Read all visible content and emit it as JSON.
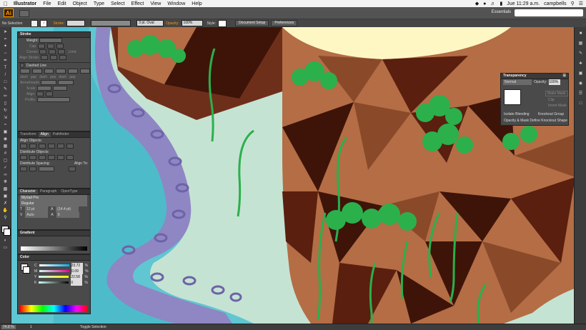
{
  "menubar": {
    "app_name": "Illustrator",
    "items": [
      "File",
      "Edit",
      "Object",
      "Type",
      "Select",
      "Effect",
      "View",
      "Window",
      "Help"
    ],
    "clock": "Jue 11:29 a.m.",
    "user": "campbells"
  },
  "appbar": {
    "logo": "Ai",
    "workspace": "Essentials"
  },
  "controlbar": {
    "selection": "No Selection",
    "stroke_label": "Stroke:",
    "brush": "3 pt. Oval",
    "opacity_label": "Opacity:",
    "opacity_value": "100%",
    "style_label": "Style:",
    "doc_setup": "Document Setup",
    "preferences": "Preferences"
  },
  "stroke_panel": {
    "title": "Stroke",
    "rows": [
      "Weight:",
      "Cap:",
      "Corner:",
      "Align Stroke:"
    ],
    "limit_label": "Limit:",
    "dashed": "Dashed Line",
    "dash_labels": [
      "dash",
      "gap",
      "dash",
      "gap",
      "dash",
      "gap"
    ],
    "arrowheads": "Arrowheads:",
    "scale": "Scale:",
    "align": "Align:",
    "profile": "Profile:"
  },
  "align_panel": {
    "tabs": [
      "Transform",
      "Align",
      "Pathfinder"
    ],
    "align_objects": "Align Objects:",
    "distribute_objects": "Distribute Objects:",
    "distribute_spacing": "Distribute Spacing:",
    "align_to": "Align To:"
  },
  "character_panel": {
    "tabs": [
      "Character",
      "Paragraph",
      "OpenType"
    ],
    "font": "Myriad Pro",
    "style": "Regular",
    "size": "12 pt",
    "leading": "(14.4 pt)",
    "kerning": "Auto",
    "tracking": "0"
  },
  "gradient_panel": {
    "title": "Gradient"
  },
  "color_panel": {
    "title": "Color",
    "channels": [
      {
        "label": "C",
        "value": "23.72",
        "unit": "%"
      },
      {
        "label": "M",
        "value": "0.09",
        "unit": "%"
      },
      {
        "label": "Y",
        "value": "22.58",
        "unit": "%"
      },
      {
        "label": "K",
        "value": "0",
        "unit": "%"
      }
    ]
  },
  "transparency_panel": {
    "title": "Transparency",
    "blend": "Normal",
    "opacity_label": "Opacity:",
    "opacity_value": "100%",
    "make_mask": "Make Mask",
    "clip": "Clip",
    "invert_mask": "Invert Mask",
    "isolate": "Isolate Blending",
    "knockout": "Knockout Group",
    "opacity_mask": "Opacity & Mask Define Knockout Shape"
  },
  "statusbar": {
    "zoom": "74.8 %",
    "page": "1",
    "tool_status": "Toggle Selection"
  },
  "colors": {
    "river": "#5fc6d2",
    "tentacle": "#8f86c4",
    "ground": "#c5e3d3",
    "cliff_light": "#b46d45",
    "cliff_dark": "#3e1409",
    "tree": "#2bb04c",
    "sky": "#fef7c4"
  }
}
